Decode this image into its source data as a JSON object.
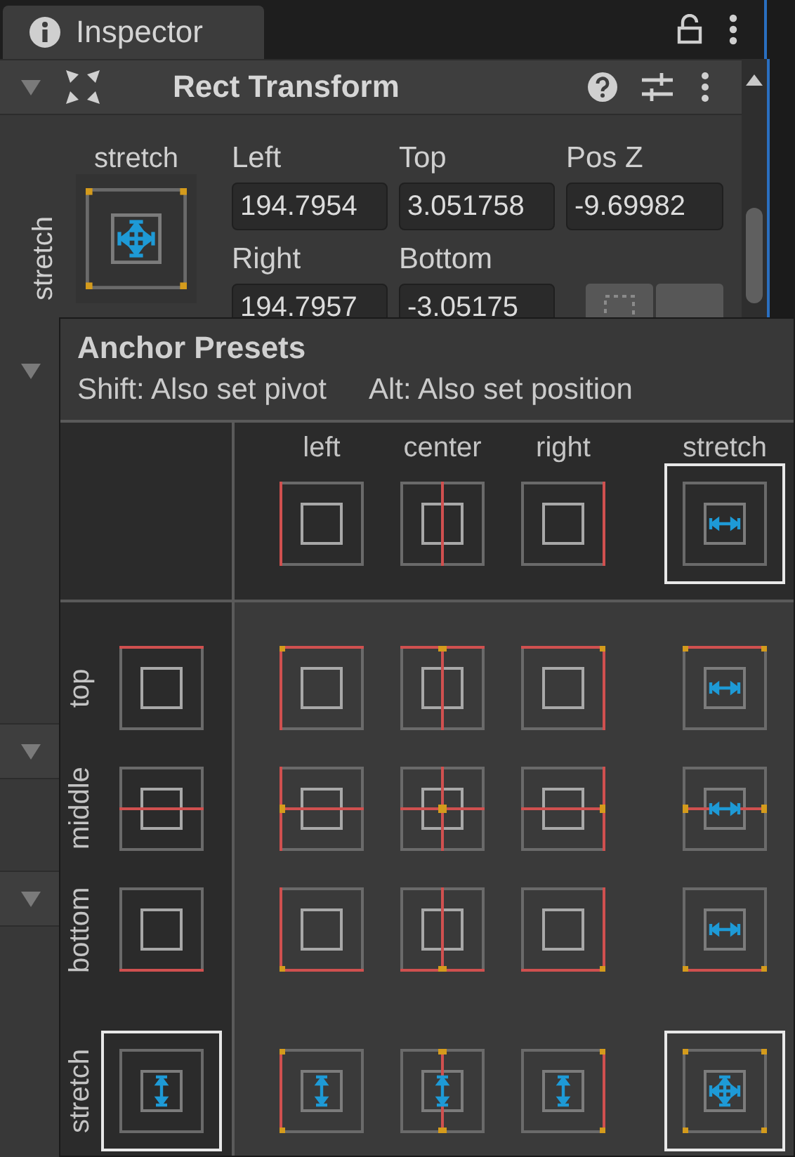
{
  "tab": {
    "title": "Inspector"
  },
  "component": {
    "title": "Rect Transform",
    "expanded": true
  },
  "anchor_widget": {
    "horizontal_label": "stretch",
    "vertical_label": "stretch"
  },
  "fields": [
    {
      "label": "Left",
      "value": "194.7954"
    },
    {
      "label": "Top",
      "value": "3.051758"
    },
    {
      "label": "Pos Z",
      "value": "-9.69982"
    },
    {
      "label": "Right",
      "value": "194.7957"
    },
    {
      "label": "Bottom",
      "value": "-3.05175"
    }
  ],
  "anchors_foldout": {
    "expanded": true
  },
  "other_components": [
    {
      "expanded": true
    },
    {
      "expanded": true
    }
  ],
  "popup": {
    "title": "Anchor Presets",
    "hints": [
      "Shift: Also set pivot",
      "Alt: Also set position"
    ],
    "columns": [
      {
        "label": "left",
        "selected": false
      },
      {
        "label": "center",
        "selected": false
      },
      {
        "label": "right",
        "selected": false
      },
      {
        "label": "stretch",
        "selected": true
      }
    ],
    "rows": [
      {
        "label": "top",
        "selected": false,
        "presets": [
          {
            "selected": false
          },
          {
            "selected": false
          },
          {
            "selected": false
          },
          {
            "selected": false
          }
        ]
      },
      {
        "label": "middle",
        "selected": false,
        "presets": [
          {
            "selected": false
          },
          {
            "selected": false
          },
          {
            "selected": false
          },
          {
            "selected": false
          }
        ]
      },
      {
        "label": "bottom",
        "selected": false,
        "presets": [
          {
            "selected": false
          },
          {
            "selected": false
          },
          {
            "selected": false
          },
          {
            "selected": false
          }
        ]
      },
      {
        "label": "stretch",
        "selected": true,
        "presets": [
          {
            "selected": false
          },
          {
            "selected": false
          },
          {
            "selected": false
          },
          {
            "selected": true
          }
        ]
      }
    ]
  }
}
